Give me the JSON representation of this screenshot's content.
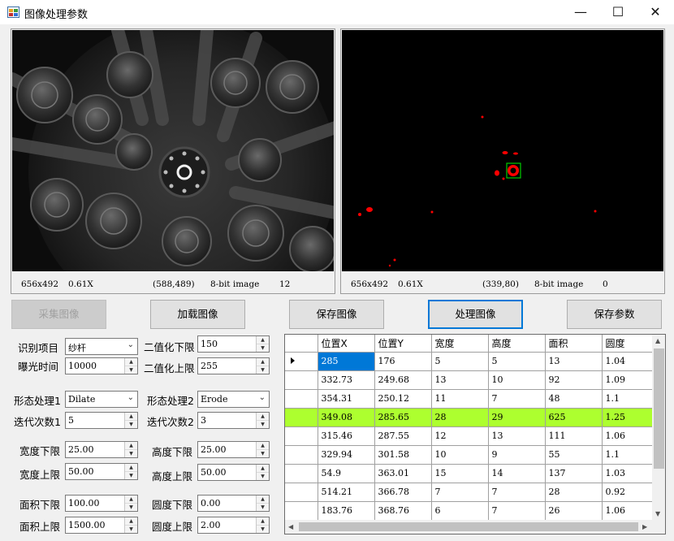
{
  "window": {
    "title": "图像处理参数",
    "controls": [
      "—",
      "☐",
      "✕"
    ]
  },
  "left_viewer": {
    "size": "656x492",
    "zoom": "0.61X",
    "coords": "(588,489)",
    "type": "8-bit image",
    "value": "12"
  },
  "right_viewer": {
    "size": "656x492",
    "zoom": "0.61X",
    "coords": "(339,80)",
    "type": "8-bit image",
    "value": "0"
  },
  "buttons": {
    "capture": "采集图像",
    "load": "加载图像",
    "save_image": "保存图像",
    "process": "处理图像",
    "save_params": "保存参数"
  },
  "params": {
    "recognize_label": "识别项目",
    "recognize_value": "纱杆",
    "exposure_label": "曝光时间",
    "exposure_value": "10000",
    "bin_low_label": "二值化下限",
    "bin_low_value": "150",
    "bin_high_label": "二值化上限",
    "bin_high_value": "255",
    "morph1_label": "形态处理1",
    "morph1_value": "Dilate",
    "morph2_label": "形态处理2",
    "morph2_value": "Erode",
    "iter1_label": "迭代次数1",
    "iter1_value": "5",
    "iter2_label": "迭代次数2",
    "iter2_value": "3",
    "width_low_label": "宽度下限",
    "width_low_value": "25.00",
    "width_high_label": "宽度上限",
    "width_high_value": "50.00",
    "height_low_label": "高度下限",
    "height_low_value": "25.00",
    "height_high_label": "高度上限",
    "height_high_value": "50.00",
    "area_low_label": "面积下限",
    "area_low_value": "100.00",
    "area_high_label": "面积上限",
    "area_high_value": "1500.00",
    "round_low_label": "圆度下限",
    "round_low_value": "0.00",
    "round_high_label": "圆度上限",
    "round_high_value": "2.00"
  },
  "table": {
    "columns": [
      "位置X",
      "位置Y",
      "宽度",
      "高度",
      "面积",
      "圆度"
    ],
    "rows": [
      [
        "285",
        "176",
        "5",
        "5",
        "13",
        "1.04"
      ],
      [
        "332.73",
        "249.68",
        "13",
        "10",
        "92",
        "1.09"
      ],
      [
        "354.31",
        "250.12",
        "11",
        "7",
        "48",
        "1.1"
      ],
      [
        "349.08",
        "285.65",
        "28",
        "29",
        "625",
        "1.25"
      ],
      [
        "315.46",
        "287.55",
        "12",
        "13",
        "111",
        "1.06"
      ],
      [
        "329.94",
        "301.58",
        "10",
        "9",
        "55",
        "1.1"
      ],
      [
        "54.9",
        "363.01",
        "15",
        "14",
        "137",
        "1.03"
      ],
      [
        "514.21",
        "366.78",
        "7",
        "7",
        "28",
        "0.92"
      ],
      [
        "183.76",
        "368.76",
        "6",
        "7",
        "26",
        "1.06"
      ]
    ],
    "highlight_row": 3,
    "selected_row": 0,
    "highlight_color": "#adff2f",
    "selection_color": "#0078d7"
  },
  "colors": {
    "blob": "#ff0000",
    "roi_box": "#00cc00"
  }
}
